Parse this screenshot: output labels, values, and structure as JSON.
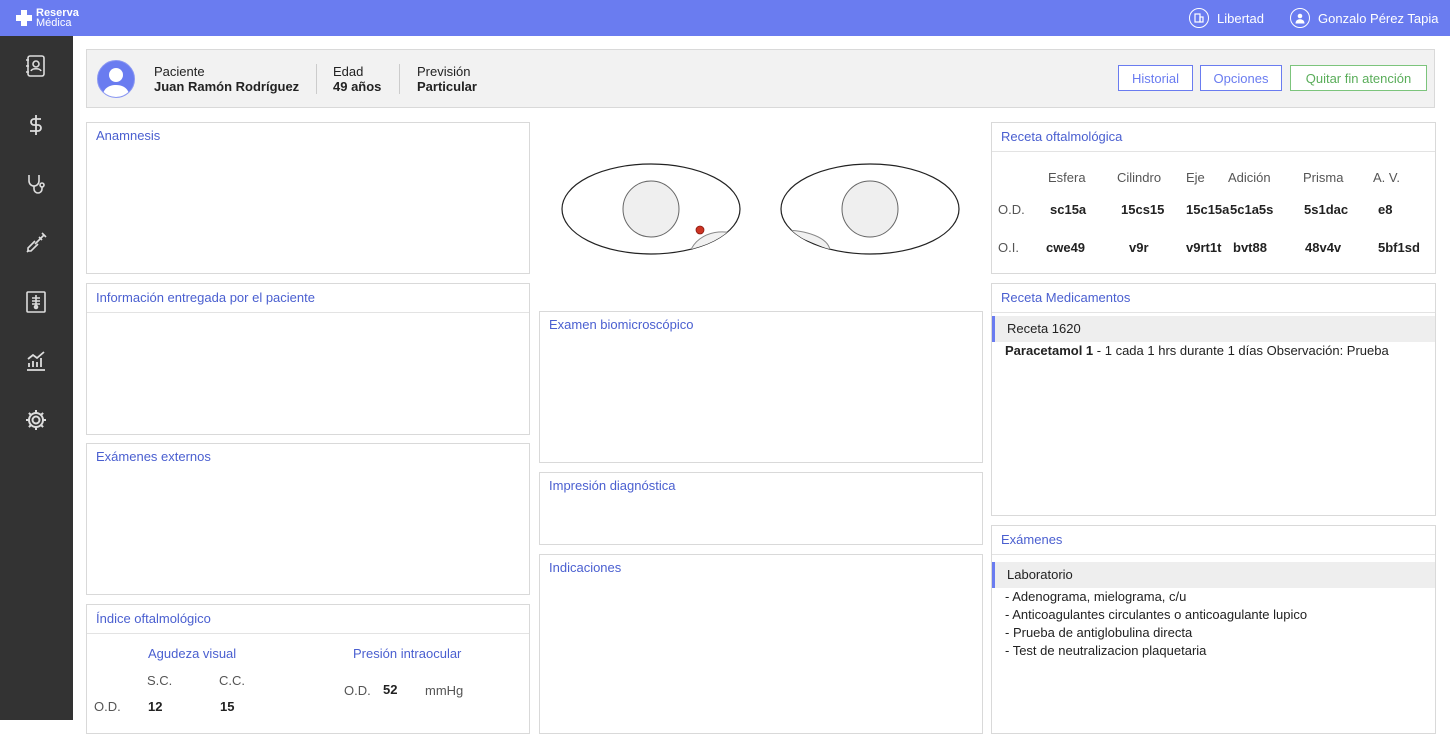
{
  "header": {
    "logo_line1": "Reserva",
    "logo_line2": "Médica",
    "center": "Libertad",
    "user": "Gonzalo Pérez Tapia"
  },
  "sidebar": {
    "items": [
      "patients-icon",
      "dollar-icon",
      "stethoscope-icon",
      "syringe-icon",
      "xray-icon",
      "chart-icon",
      "gear-icon"
    ]
  },
  "patient": {
    "name_label": "Paciente",
    "name": "Juan Ramón Rodríguez",
    "age_label": "Edad",
    "age": "49 años",
    "insurance_label": "Previsión",
    "insurance": "Particular"
  },
  "actions": {
    "history": "Historial",
    "options": "Opciones",
    "remove_end": "Quitar fin atención"
  },
  "panels": {
    "anamnesis": "Anamnesis",
    "patient_info": "Información entregada por el paciente",
    "external_exams": "Exámenes externos",
    "ophth_index": "Índice oftalmológico",
    "biomicroscopic": "Examen biomicroscópico",
    "diagnosis": "Impresión diagnóstica",
    "indications": "Indicaciones",
    "ophth_rx": "Receta oftalmológica",
    "med_rx": "Receta Medicamentos",
    "exams": "Exámenes"
  },
  "ophth_index": {
    "visual_acuity": "Agudeza visual",
    "iop": "Presión intraocular",
    "sc": "S.C.",
    "cc": "C.C.",
    "od_label": "O.D.",
    "od_sc": "12",
    "od_cc": "15",
    "iop_od_label": "O.D.",
    "iop_od": "52",
    "iop_unit": "mmHg"
  },
  "ophth_rx": {
    "columns": [
      "Esfera",
      "Cilindro",
      "Eje",
      "Adición",
      "Prisma",
      "A. V."
    ],
    "rows": [
      {
        "label": "O.D.",
        "values": [
          "sc15a",
          "15cs15",
          "15c15a",
          "5c1a5s",
          "5s1dac",
          "e8"
        ]
      },
      {
        "label": "O.I.",
        "values": [
          "cwe49",
          "v9r",
          "v9rt1t",
          "bvt88",
          "48v4v",
          "5bf1sd"
        ]
      }
    ]
  },
  "med_rx": {
    "title": "Receta 1620",
    "drug": "Paracetamol 1",
    "detail": " - 1 cada 1 hrs durante 1 días Observación: Prueba"
  },
  "exams": {
    "group": "Laboratorio",
    "items": [
      "- Adenograma, mielograma, c/u",
      "- Anticoagulantes circulantes o anticoagulante lupico",
      "- Prueba de antiglobulina directa",
      "- Test de neutralizacion plaquetaria"
    ]
  },
  "colors": {
    "accent": "#6a7cf0",
    "sidebar": "#333333",
    "title": "#4a5fd0",
    "green": "#5aad5a",
    "marker": "#cc3322"
  }
}
